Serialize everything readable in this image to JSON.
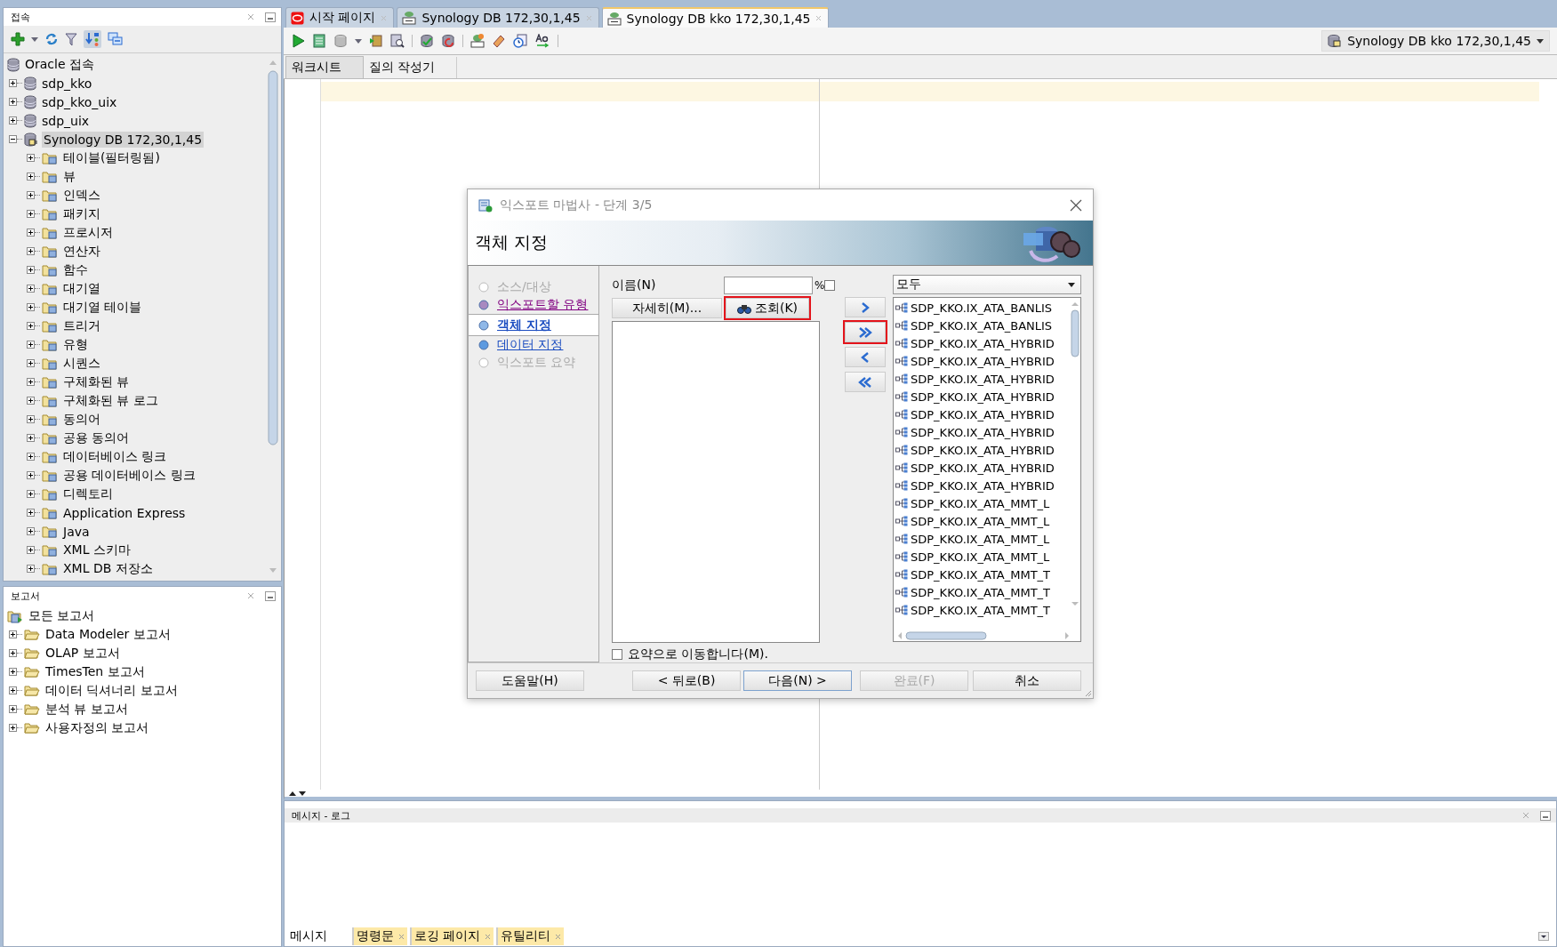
{
  "connections_panel": {
    "title": "접속",
    "tree": [
      {
        "label": "Oracle 접속",
        "kind": "root",
        "selected": false,
        "children": [
          {
            "label": "sdp_kko",
            "kind": "database",
            "expanded": false,
            "selected": false
          },
          {
            "label": "sdp_kko_uix",
            "kind": "database",
            "expanded": false,
            "selected": false
          },
          {
            "label": "sdp_uix",
            "kind": "database",
            "expanded": false,
            "selected": false
          },
          {
            "label": "Synology DB 172,30,1,45",
            "kind": "connected_database",
            "expanded": true,
            "selected": true,
            "children": [
              {
                "label": "테이블(필터링됨)",
                "kind": "folder",
                "expanded": false,
                "selected": false
              },
              {
                "label": "뷰",
                "kind": "folder",
                "expanded": false,
                "selected": false
              },
              {
                "label": "인덱스",
                "kind": "folder",
                "expanded": false,
                "selected": false
              },
              {
                "label": "패키지",
                "kind": "folder",
                "expanded": false,
                "selected": false
              },
              {
                "label": "프로시저",
                "kind": "folder",
                "expanded": false,
                "selected": false
              },
              {
                "label": "연산자",
                "kind": "folder",
                "expanded": false,
                "selected": false
              },
              {
                "label": "함수",
                "kind": "folder",
                "expanded": false,
                "selected": false
              },
              {
                "label": "대기열",
                "kind": "folder",
                "expanded": false,
                "selected": false
              },
              {
                "label": "대기열 테이블",
                "kind": "folder",
                "expanded": false,
                "selected": false
              },
              {
                "label": "트리거",
                "kind": "folder",
                "expanded": false,
                "selected": false
              },
              {
                "label": "유형",
                "kind": "folder",
                "expanded": false,
                "selected": false
              },
              {
                "label": "시퀀스",
                "kind": "folder",
                "expanded": false,
                "selected": false
              },
              {
                "label": "구체화된 뷰",
                "kind": "folder",
                "expanded": false,
                "selected": false
              },
              {
                "label": "구체화된 뷰 로그",
                "kind": "folder",
                "expanded": false,
                "selected": false
              },
              {
                "label": "동의어",
                "kind": "folder",
                "expanded": false,
                "selected": false
              },
              {
                "label": "공용 동의어",
                "kind": "folder",
                "expanded": false,
                "selected": false
              },
              {
                "label": "데이터베이스 링크",
                "kind": "folder",
                "expanded": false,
                "selected": false
              },
              {
                "label": "공용 데이터베이스 링크",
                "kind": "folder",
                "expanded": false,
                "selected": false
              },
              {
                "label": "디렉토리",
                "kind": "folder",
                "expanded": false,
                "selected": false
              },
              {
                "label": "Application Express",
                "kind": "folder",
                "expanded": false,
                "selected": false
              },
              {
                "label": "Java",
                "kind": "folder",
                "expanded": false,
                "selected": false
              },
              {
                "label": "XML 스키마",
                "kind": "folder",
                "expanded": false,
                "selected": false
              },
              {
                "label": "XML DB 저장소",
                "kind": "folder",
                "expanded": false,
                "selected": false
              }
            ]
          }
        ]
      }
    ]
  },
  "reports_panel": {
    "title": "보고서",
    "tree": [
      {
        "label": "모든 보고서",
        "kind": "root",
        "selected": false,
        "children": [
          {
            "label": "Data Modeler 보고서",
            "kind": "report_folder",
            "expanded": false,
            "selected": false
          },
          {
            "label": "OLAP 보고서",
            "kind": "report_folder",
            "expanded": false,
            "selected": false
          },
          {
            "label": "TimesTen 보고서",
            "kind": "report_folder",
            "expanded": false,
            "selected": false
          },
          {
            "label": "데이터 딕셔너리 보고서",
            "kind": "report_folder",
            "expanded": false,
            "selected": false
          },
          {
            "label": "분석 뷰 보고서",
            "kind": "report_folder",
            "expanded": false,
            "selected": false
          },
          {
            "label": "사용자정의 보고서",
            "kind": "report_folder",
            "expanded": false,
            "selected": false
          }
        ]
      }
    ]
  },
  "document_tabs": [
    {
      "label": "시작 페이지",
      "kind": "start",
      "selected": false
    },
    {
      "label": "Synology DB 172,30,1,45",
      "kind": "sql",
      "selected": false
    },
    {
      "label": "Synology DB kko 172,30,1,45",
      "kind": "sql",
      "selected": true
    }
  ],
  "connection_selector": {
    "value": "Synology DB kko 172,30,1,45"
  },
  "editor_tabs": [
    {
      "label": "워크시트",
      "selected": true
    },
    {
      "label": "질의 작성기",
      "selected": false
    }
  ],
  "dialog": {
    "title": "익스포트 마법사 - 단계 3/5",
    "heading": "객체 지정",
    "steps": [
      {
        "label": "소스/대상",
        "selected": false,
        "disabled": true,
        "visited": false
      },
      {
        "label": "익스포트할 유형",
        "selected": false,
        "disabled": false,
        "visited": true
      },
      {
        "label": "객체 지정",
        "selected": true,
        "disabled": false,
        "visited": false
      },
      {
        "label": "데이터 지정",
        "selected": false,
        "disabled": false,
        "visited": false
      },
      {
        "label": "익스포트 요약",
        "selected": false,
        "disabled": true,
        "visited": false
      }
    ],
    "name_label": "이름(N)",
    "percent": "%",
    "percent_checked": false,
    "more_button": {
      "label": "자세히(M)...",
      "highlighted": false
    },
    "lookup_button": {
      "label": "조회(K)",
      "highlighted": true
    },
    "move_buttons": [
      {
        "kind": "add",
        "highlighted": false
      },
      {
        "kind": "add_all",
        "highlighted": true
      },
      {
        "kind": "remove",
        "highlighted": false
      },
      {
        "kind": "remove_all",
        "highlighted": false
      }
    ],
    "filter": {
      "value": "모두"
    },
    "available_objects": [
      "SDP_KKO.IX_ATA_BANLIS",
      "SDP_KKO.IX_ATA_BANLIS",
      "SDP_KKO.IX_ATA_HYBRID",
      "SDP_KKO.IX_ATA_HYBRID",
      "SDP_KKO.IX_ATA_HYBRID",
      "SDP_KKO.IX_ATA_HYBRID",
      "SDP_KKO.IX_ATA_HYBRID",
      "SDP_KKO.IX_ATA_HYBRID",
      "SDP_KKO.IX_ATA_HYBRID",
      "SDP_KKO.IX_ATA_HYBRID",
      "SDP_KKO.IX_ATA_HYBRID",
      "SDP_KKO.IX_ATA_MMT_L",
      "SDP_KKO.IX_ATA_MMT_L",
      "SDP_KKO.IX_ATA_MMT_L",
      "SDP_KKO.IX_ATA_MMT_L",
      "SDP_KKO.IX_ATA_MMT_T",
      "SDP_KKO.IX_ATA_MMT_T",
      "SDP_KKO.IX_ATA_MMT_T"
    ],
    "skip_to_summary": {
      "label": "요약으로 이동합니다(M).",
      "checked": false
    },
    "buttons": [
      {
        "label": "도움말(H)",
        "disabled": false,
        "default": false
      },
      {
        "label": "< 뒤로(B)",
        "disabled": false,
        "default": false
      },
      {
        "label": "다음(N) >",
        "disabled": false,
        "default": true
      },
      {
        "label": "완료(F)",
        "disabled": true,
        "default": false
      },
      {
        "label": "취소",
        "disabled": false,
        "default": false
      }
    ]
  },
  "message_panel": {
    "title": "메시지 - 로그",
    "tabs": [
      {
        "label": "메시지",
        "selected": true,
        "closable": false
      },
      {
        "label": "명령문",
        "selected": false,
        "closable": true
      },
      {
        "label": "로깅 페이지",
        "selected": false,
        "closable": true
      },
      {
        "label": "유틸리티",
        "selected": false,
        "closable": true
      }
    ]
  }
}
